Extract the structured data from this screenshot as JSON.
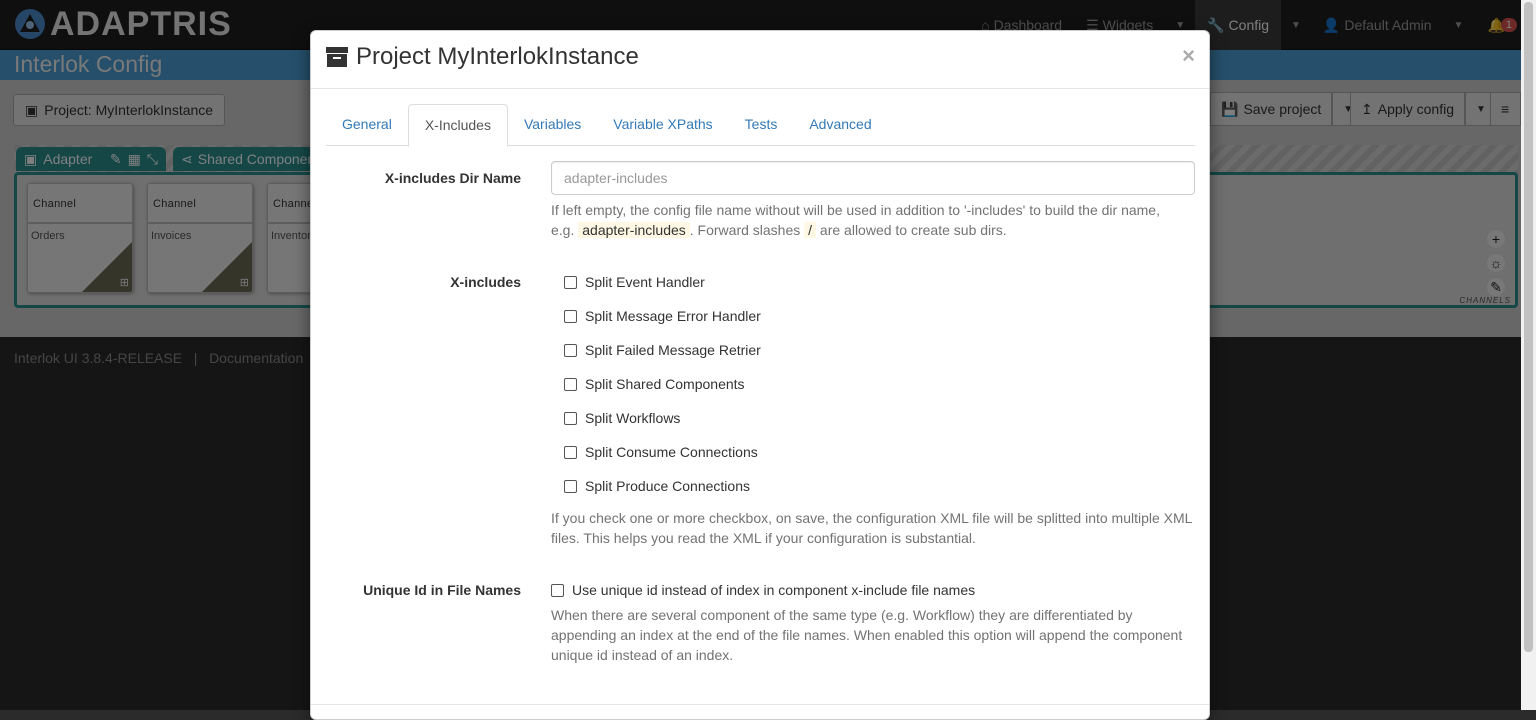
{
  "topnav": {
    "logo_text": "ADAPTRIS",
    "items": [
      {
        "label": "Dashboard",
        "icon": "home-icon"
      },
      {
        "label": "Widgets",
        "icon": "list-icon"
      },
      {
        "label": "Config",
        "icon": "wrench-icon"
      },
      {
        "label": "Default Admin",
        "icon": "user-icon"
      }
    ],
    "notification_count": "1"
  },
  "app": {
    "title": "Interlok Config",
    "project_button": "Project: MyInterlokInstance",
    "save_button": "Save project",
    "apply_button": "Apply config",
    "adapter_tab": "Adapter",
    "shared_tab": "Shared Components",
    "channels": [
      {
        "type": "Channel",
        "name": "Orders"
      },
      {
        "type": "Channel",
        "name": "Invoices"
      },
      {
        "type": "Channel",
        "name": "Inventory"
      }
    ],
    "channels_label": "CHANNELS",
    "footer_version": "Interlok UI  3.8.4-RELEASE",
    "footer_sep": "|",
    "footer_docs": "Documentation"
  },
  "modal": {
    "title": "Project MyInterlokInstance",
    "close": "×",
    "tabs": [
      "General",
      "X-Includes",
      "Variables",
      "Variable XPaths",
      "Tests",
      "Advanced"
    ],
    "active_tab": "X-Includes",
    "dir_name_label": "X-includes Dir Name",
    "dir_name_placeholder": "adapter-includes",
    "dir_help_1": "If left empty, the config file name without will be used in addition to '-includes' to build the dir name,",
    "dir_help_2a": "e.g.",
    "dir_help_code": "adapter-includes",
    "dir_help_2b": ". Forward slashes",
    "dir_help_slash": "/",
    "dir_help_2c": "are allowed to create sub dirs.",
    "xincludes_label": "X-includes",
    "checkboxes": [
      "Split Event Handler",
      "Split Message Error Handler",
      "Split Failed Message Retrier",
      "Split Shared Components",
      "Split Workflows",
      "Split Consume Connections",
      "Split Produce Connections"
    ],
    "xincludes_help": "If you check one or more checkbox, on save, the configuration XML file will be splitted into multiple XML files. This helps you read the XML if your configuration is substantial.",
    "unique_label": "Unique Id in File Names",
    "unique_checkbox": "Use unique id instead of index in component x-include file names",
    "unique_help": "When there are several component of the same type (e.g. Workflow) they are differentiated by appending an index at the end of the file names. When enabled this option will append the component unique id instead of an index."
  }
}
